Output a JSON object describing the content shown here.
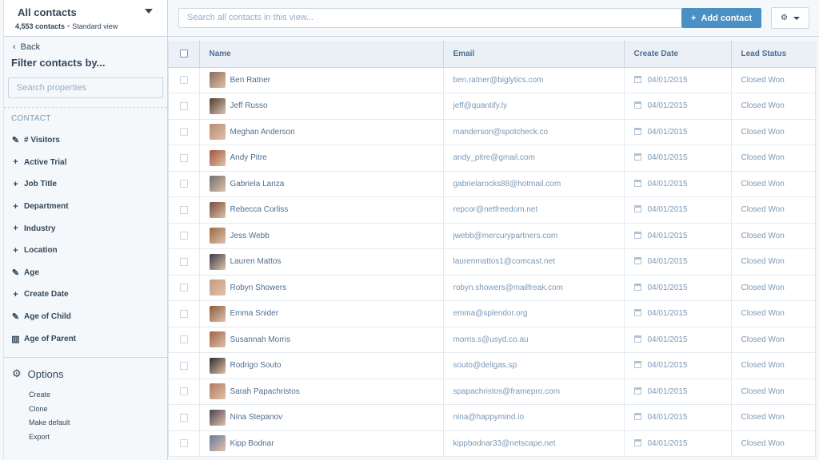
{
  "sidebar": {
    "view_title": "All contacts",
    "contact_count": "4,553 contacts",
    "view_type": "Standard view",
    "back_label": "Back",
    "filter_title": "Filter contacts by...",
    "search_placeholder": "Search properties",
    "section_label": "CONTACT",
    "properties": [
      {
        "label": "# Visitors",
        "icon": "edit-icon"
      },
      {
        "label": "Active Trial",
        "icon": "plus-icon"
      },
      {
        "label": "Job Title",
        "icon": "plus-icon"
      },
      {
        "label": "Department",
        "icon": "plus-icon"
      },
      {
        "label": "Industry",
        "icon": "plus-icon"
      },
      {
        "label": "Location",
        "icon": "plus-icon"
      },
      {
        "label": "Age",
        "icon": "edit-icon"
      },
      {
        "label": "Create Date",
        "icon": "plus-icon"
      },
      {
        "label": "Age of Child",
        "icon": "edit-icon"
      },
      {
        "label": "Age of Parent",
        "icon": "bar-chart-icon"
      }
    ],
    "options_title": "Options",
    "options": [
      "Create",
      "Clone",
      "Make default",
      "Export"
    ]
  },
  "toolbar": {
    "search_placeholder": "Search all contacts in this view...",
    "add_label": "Add contact"
  },
  "table": {
    "headers": [
      "Name",
      "Email",
      "Create Date",
      "Lead Status"
    ],
    "rows": [
      {
        "name": "Ben Ratner",
        "email": "ben.ratner@biglytics.com",
        "date": "04/01/2015",
        "status": "Closed Won"
      },
      {
        "name": "Jeff Russo",
        "email": "jeff@quantify.ly",
        "date": "04/01/2015",
        "status": "Closed Won"
      },
      {
        "name": "Meghan Anderson",
        "email": "manderson@spotcheck.co",
        "date": "04/01/2015",
        "status": "Closed Won"
      },
      {
        "name": "Andy Pitre",
        "email": "andy_pitre@gmail.com",
        "date": "04/01/2015",
        "status": "Closed Won"
      },
      {
        "name": "Gabriela Lanza",
        "email": "gabrielarocks88@hotmail.com",
        "date": "04/01/2015",
        "status": "Closed Won"
      },
      {
        "name": "Rebecca Corliss",
        "email": "repcor@netfreedom.net",
        "date": "04/01/2015",
        "status": "Closed Won"
      },
      {
        "name": "Jess Webb",
        "email": "jwebb@mercurypartners.com",
        "date": "04/01/2015",
        "status": "Closed Won"
      },
      {
        "name": "Lauren Mattos",
        "email": "laurenmattos1@comcast.net",
        "date": "04/01/2015",
        "status": "Closed Won"
      },
      {
        "name": "Robyn Showers",
        "email": "robyn.showers@mailfreak.com",
        "date": "04/01/2015",
        "status": "Closed Won"
      },
      {
        "name": "Emma Snider",
        "email": "emma@splendor.org",
        "date": "04/01/2015",
        "status": "Closed Won"
      },
      {
        "name": "Susannah Morris",
        "email": "morris.s@usyd.co.au",
        "date": "04/01/2015",
        "status": "Closed Won"
      },
      {
        "name": "Rodrigo Souto",
        "email": "souto@deligas.sp",
        "date": "04/01/2015",
        "status": "Closed Won"
      },
      {
        "name": "Sarah Papachristos",
        "email": "spapachristos@framepro.com",
        "date": "04/01/2015",
        "status": "Closed Won"
      },
      {
        "name": "Nina Stepanov",
        "email": "nina@happymind.io",
        "date": "04/01/2015",
        "status": "Closed Won"
      },
      {
        "name": "Kipp Bodnar",
        "email": "kippbodnar33@netscape.net",
        "date": "04/01/2015",
        "status": "Closed Won"
      }
    ]
  },
  "colors": {
    "accent": "#4a90c4",
    "text": "#33475b",
    "muted": "#7c98b6"
  }
}
